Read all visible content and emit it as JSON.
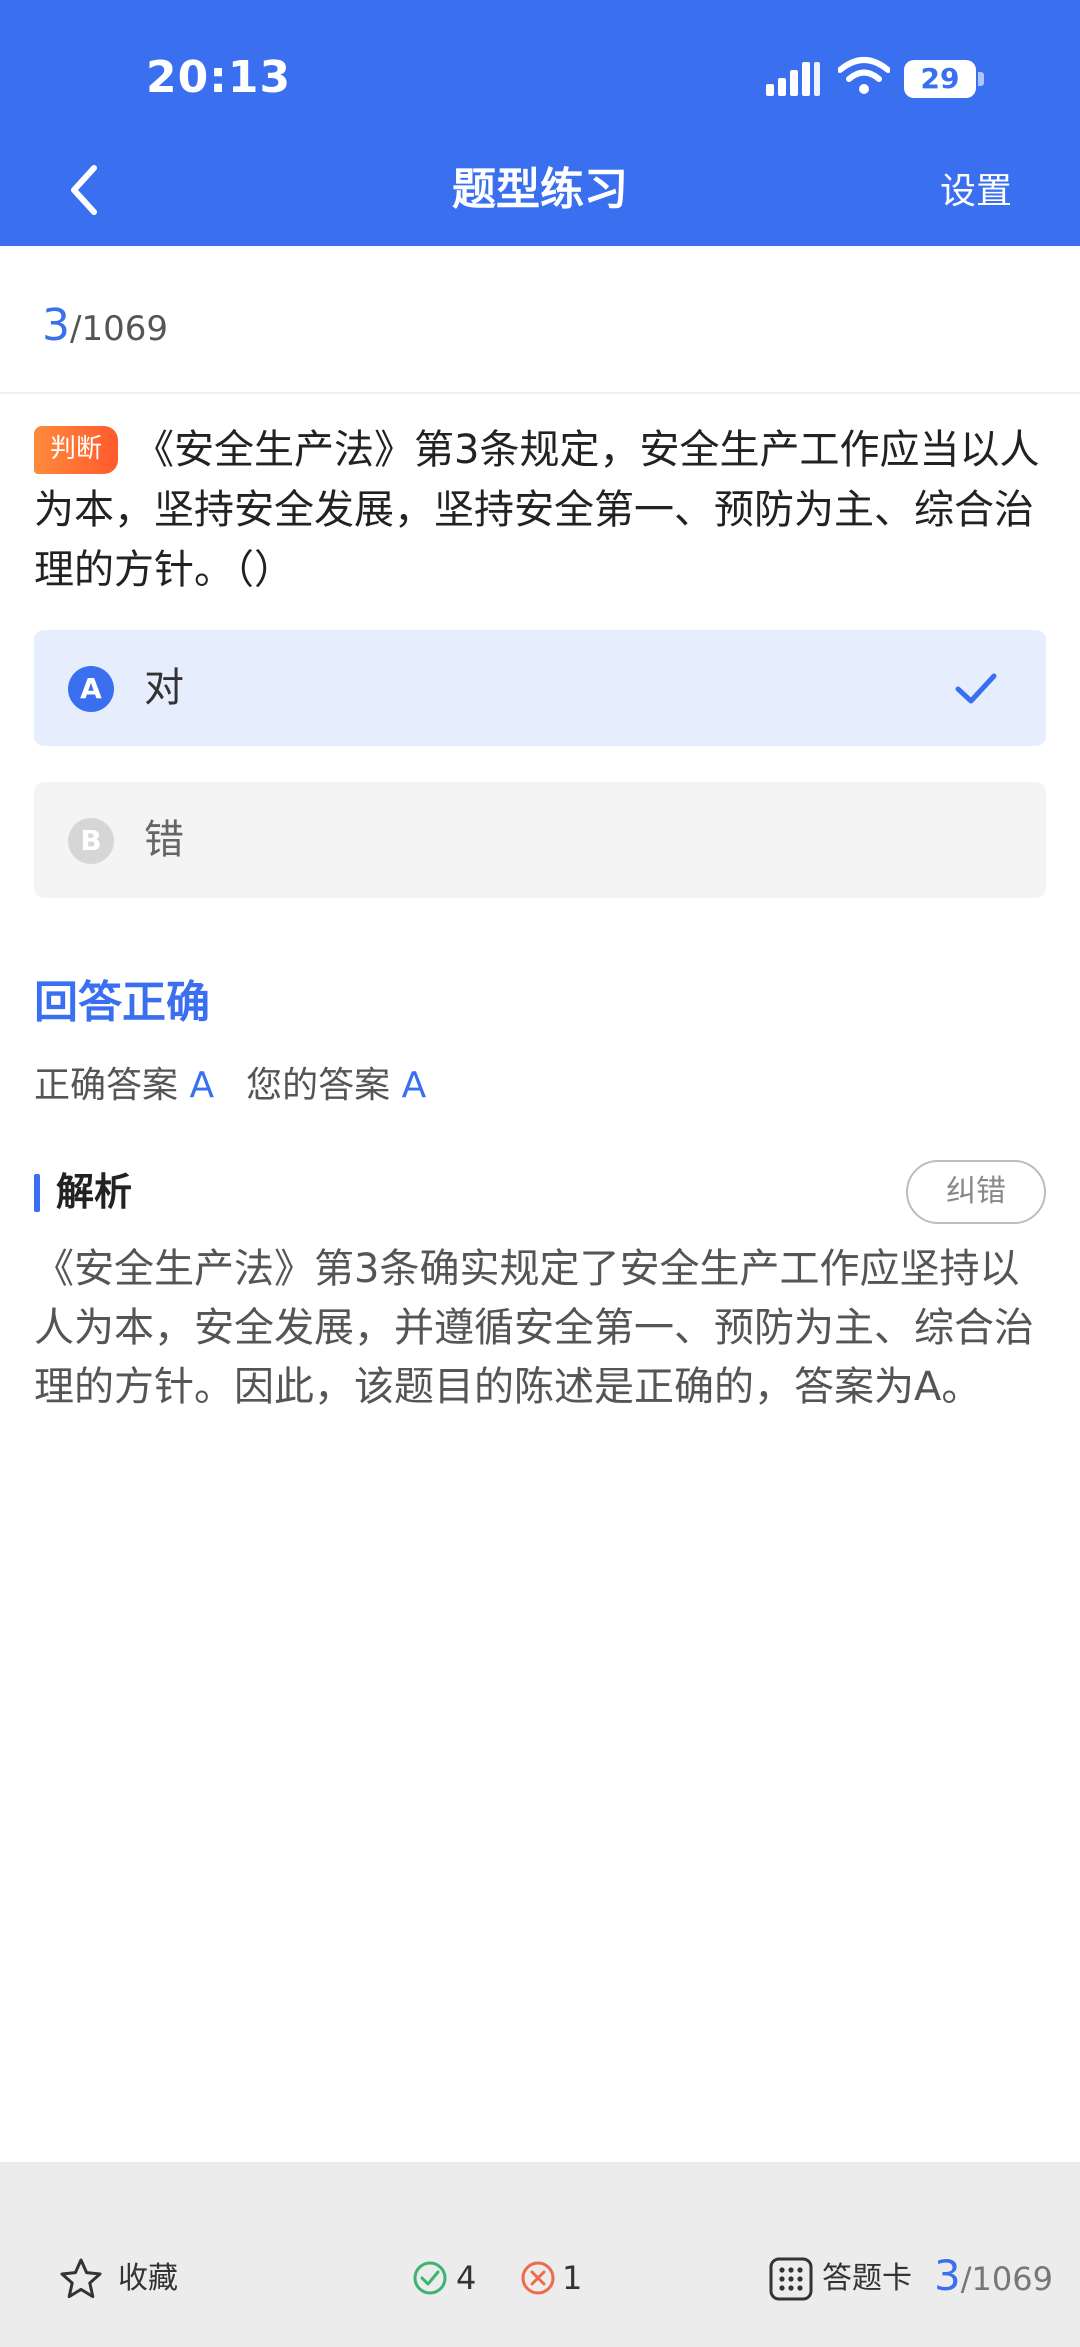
{
  "status_bar": {
    "time": "20:13",
    "battery": "29"
  },
  "nav": {
    "title": "题型练习",
    "settings": "设置"
  },
  "progress": {
    "current": "3",
    "total": "/1069"
  },
  "question": {
    "tag": "判断",
    "text": "《安全生产法》第3条规定，安全生产工作应当以人为本，坚持安全发展，坚持安全第一、预防为主、综合治理的方针。（）"
  },
  "options": [
    {
      "letter": "A",
      "text": "对",
      "selected": true
    },
    {
      "letter": "B",
      "text": "错",
      "selected": false
    }
  ],
  "result": {
    "title": "回答正确",
    "correct_label": "正确答案",
    "correct_value": "A",
    "your_label": "您的答案",
    "your_value": "A"
  },
  "analysis": {
    "title": "解析",
    "correct_button": "纠错",
    "text": "《安全生产法》第3条确实规定了安全生产工作应坚持以人为本，安全发展，并遵循安全第一、预防为主、综合治理的方针。因此，该题目的陈述是正确的，答案为A。"
  },
  "bottom_bar": {
    "favorite_label": "收藏",
    "right_count": "4",
    "wrong_count": "1",
    "answer_sheet_label": "答题卡",
    "progress_current": "3",
    "progress_total": "/1069"
  },
  "colors": {
    "primary": "#3a6ff0",
    "tag_orange": "#ff6a33",
    "right_green": "#3cb371",
    "wrong_red": "#f06a4a"
  },
  "icons": [
    "back-arrow-icon",
    "signal-icon",
    "wifi-icon",
    "battery-icon",
    "check-icon",
    "star-icon",
    "check-circle-icon",
    "close-circle-icon",
    "grid-icon"
  ]
}
